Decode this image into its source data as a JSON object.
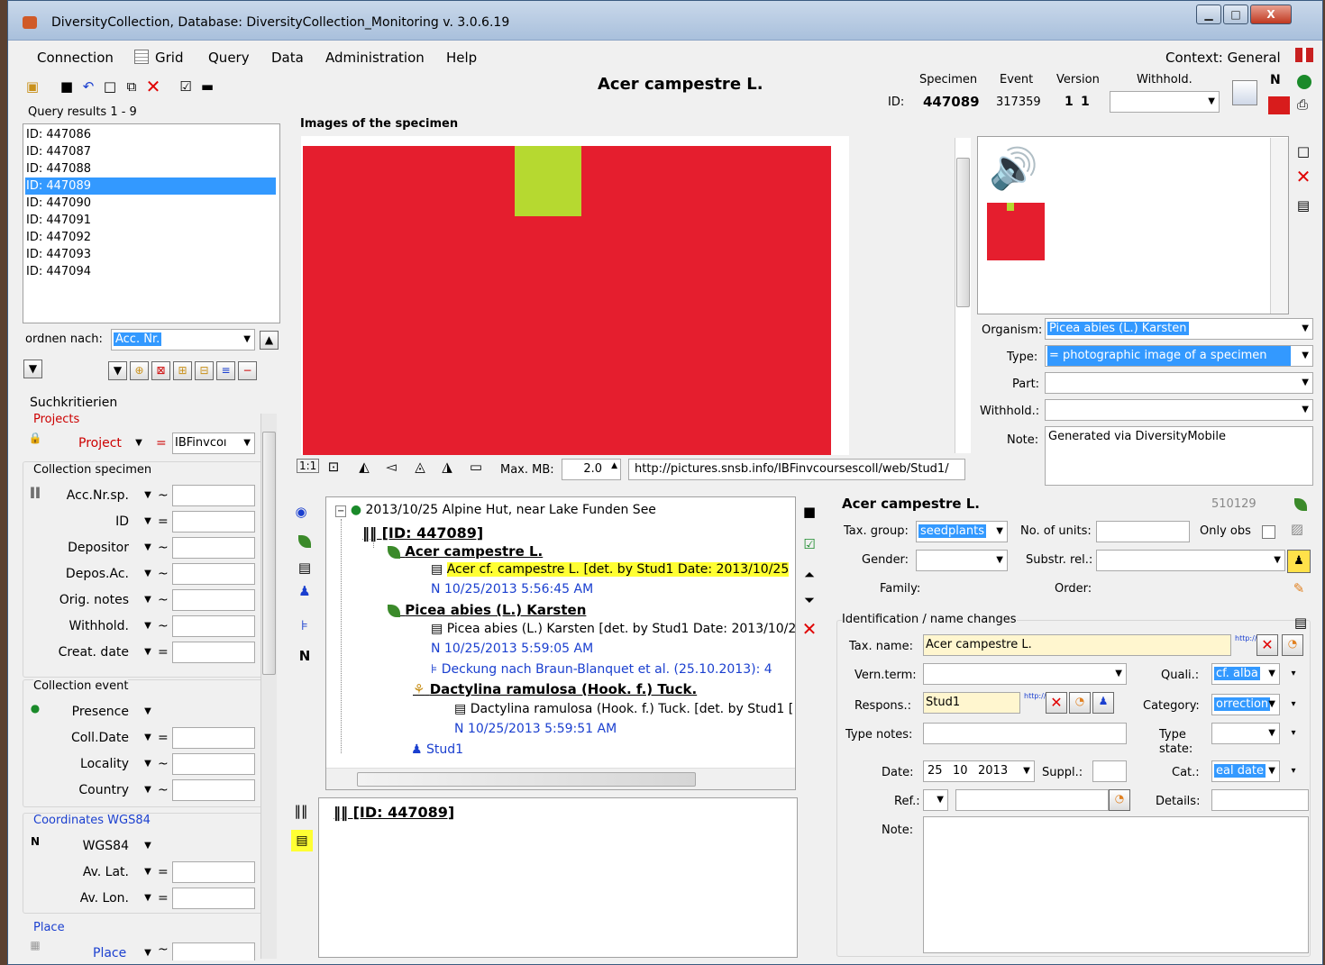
{
  "window": {
    "title": "DiversityCollection,  Database: DiversityCollection_Monitoring    v. 3.0.6.19",
    "btn_min": "▁",
    "btn_max": "□",
    "btn_close": "X"
  },
  "menu": [
    "Connection",
    "Grid",
    "Query",
    "Data",
    "Administration",
    "Help"
  ],
  "context": "Context: General",
  "header": {
    "taxon": "Acer campestre L.",
    "specimen_label": "Specimen",
    "event_label": "Event",
    "version_label": "Version",
    "withhold_label": "Withhold.",
    "id_label": "ID:",
    "specimen_id": "447089",
    "event_id": "317359",
    "version_1": "1",
    "version_2": "1"
  },
  "query": {
    "title": "Query results   1 - 9",
    "items": [
      "ID: 447086",
      "ID: 447087",
      "ID: 447088",
      "ID: 447089",
      "ID: 447090",
      "ID: 447091",
      "ID: 447092",
      "ID: 447093",
      "ID: 447094"
    ],
    "selected_index": 3,
    "order_label": "ordnen nach:",
    "order_value": "Acc. Nr."
  },
  "search": {
    "title": "Suchkritierien",
    "projects_group": "Projects",
    "project_label": "Project",
    "project_op": "=",
    "project_value": "IBFinvcoı",
    "collection_specimen": "Collection specimen",
    "fields": [
      {
        "label": "Acc.Nr.sp.",
        "op": "~"
      },
      {
        "label": "ID",
        "op": "="
      },
      {
        "label": "Depositor",
        "op": "~"
      },
      {
        "label": "Depos.Ac.",
        "op": "~"
      },
      {
        "label": "Orig. notes",
        "op": "~"
      },
      {
        "label": "Withhold.",
        "op": "~"
      },
      {
        "label": "Creat. date",
        "op": "="
      }
    ],
    "collection_event": "Collection event",
    "event_fields": [
      {
        "label": "Presence",
        "op": ""
      },
      {
        "label": "Coll.Date",
        "op": "="
      },
      {
        "label": "Locality",
        "op": "~"
      },
      {
        "label": "Country",
        "op": "~"
      }
    ],
    "coordinates": "Coordinates WGS84",
    "coord_fields": [
      {
        "label": "WGS84",
        "op": ""
      },
      {
        "label": "Av. Lat.",
        "op": "="
      },
      {
        "label": "Av. Lon.",
        "op": "="
      }
    ],
    "place": "Place",
    "place_label": "Place",
    "place_op": "~"
  },
  "images": {
    "title": "Images of the specimen",
    "maxmb_label": "Max. MB:",
    "maxmb_value": "2.0",
    "url": "http://pictures.snsb.info/IBFinvcoursescoll/web/Stud1/",
    "zoom_label": "1:1"
  },
  "media": {
    "organism_label": "Organism:",
    "organism_value": "Picea abies (L.) Karsten",
    "type_label": "Type:",
    "type_value": "  =  photographic image of a specimen",
    "part_label": "Part:",
    "withhold_label": "Withhold.:",
    "note_label": "Note:",
    "note_value": "Generated via DiversityMobile"
  },
  "tree": {
    "event": "2013/10/25 Alpine Hut, near Lake Funden See",
    "specimen": "[ID: 447089]",
    "taxon1": "Acer campestre L.",
    "ident1": "Acer cf. campestre L.   [det. by Stud1   Date: 2013/10/25",
    "time1": "10/25/2013 5:56:45 AM",
    "taxon2": "Picea abies (L.) Karsten",
    "ident2": "Picea abies (L.) Karsten   [det. by Stud1   Date: 2013/10/2",
    "time2": "10/25/2013 5:59:05 AM",
    "analysis": "Deckung nach Braun-Blanquet et al. (25.10.2013): 4",
    "taxon3": "Dactylina ramulosa (Hook. f.) Tuck.",
    "ident3": "Dactylina ramulosa (Hook. f.) Tuck.   [det. by Stud1   [",
    "time3": "10/25/2013 5:59:51 AM",
    "agent": "Stud1",
    "bottom_specimen": "[ID: 447089]"
  },
  "ident": {
    "taxon": "Acer campestre L.",
    "number": "510129",
    "taxgroup_label": "Tax. group:",
    "taxgroup_value": "seedplants",
    "units_label": "No. of units:",
    "onlyobs_label": "Only obs",
    "gender_label": "Gender:",
    "substr_label": "Substr. rel.:",
    "family_label": "Family:",
    "order_label": "Order:",
    "group_title": "Identification / name changes",
    "taxname_label": "Tax. name:",
    "taxname_value": "Acer campestre L.",
    "vernterm_label": "Vern.term:",
    "quali_label": "Quali.:",
    "quali_value": "cf. alba",
    "respons_label": "Respons.:",
    "respons_value": "Stud1",
    "category_label": "Category:",
    "category_value": "orrection",
    "typenotes_label": "Type notes:",
    "typestate_label1": "Type",
    "typestate_label2": "state:",
    "date_label": "Date:",
    "date_day": "25",
    "date_month": "10",
    "date_year": "2013",
    "suppl_label": "Suppl.:",
    "cat_label": "Cat.:",
    "cat_value": "eal date",
    "ref_label": "Ref.:",
    "details_label": "Details:",
    "note_label": "Note:",
    "link_text": "http://id.s"
  }
}
